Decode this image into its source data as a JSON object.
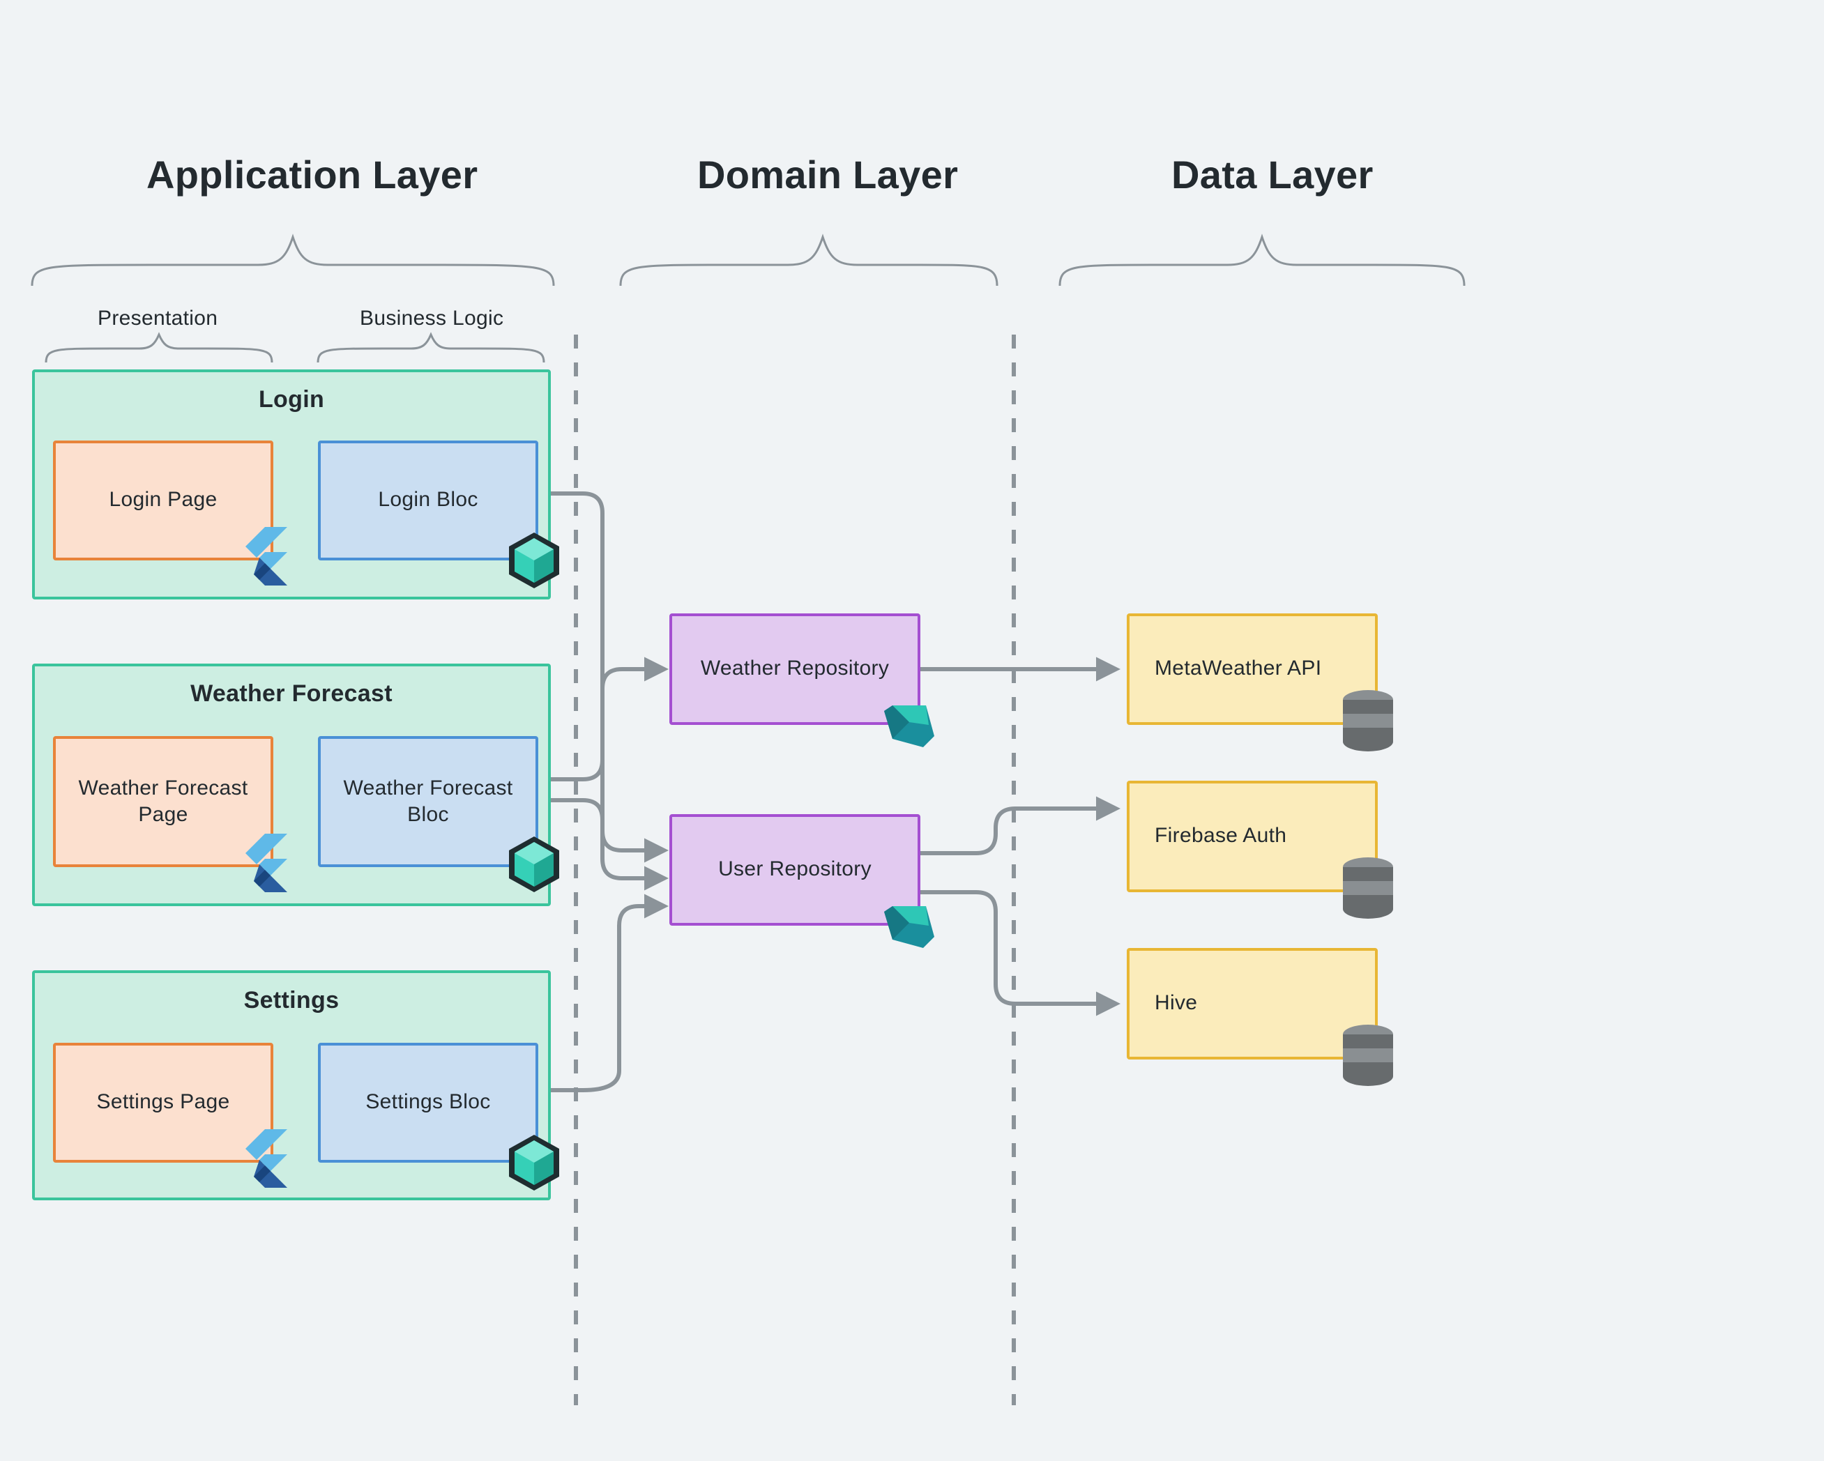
{
  "layers": {
    "application": "Application Layer",
    "domain": "Domain Layer",
    "data": "Data Layer"
  },
  "sublayers": {
    "presentation": "Presentation",
    "businessLogic": "Business Logic"
  },
  "features": {
    "login": {
      "title": "Login",
      "page": "Login Page",
      "bloc": "Login Bloc"
    },
    "weather": {
      "title": "Weather Forecast",
      "page": "Weather Forecast Page",
      "bloc": "Weather Forecast Bloc"
    },
    "settings": {
      "title": "Settings",
      "page": "Settings Page",
      "bloc": "Settings Bloc"
    }
  },
  "repositories": {
    "weather": "Weather Repository",
    "user": "User Repository"
  },
  "dataSources": {
    "metaweather": "MetaWeather API",
    "firebase": "Firebase Auth",
    "hive": "Hive"
  },
  "icons": {
    "flutter": "flutter-logo-icon",
    "bloc": "bloc-cube-icon",
    "dart": "dart-logo-icon",
    "database": "database-icon"
  }
}
